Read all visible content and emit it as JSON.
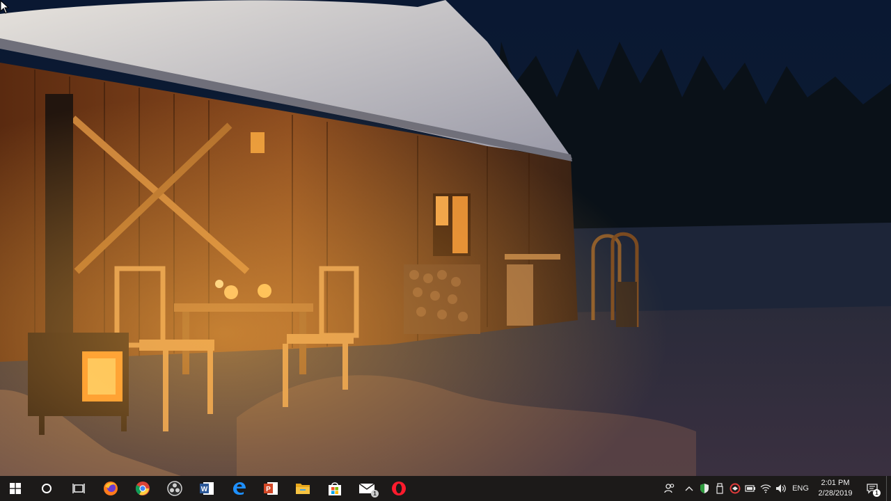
{
  "desktop": {
    "wallpaper": "snowy-cabin-at-night",
    "cursor": "arrow-cursor"
  },
  "taskbar": {
    "start": {
      "icon": "windows-logo-icon"
    },
    "search": {
      "icon": "cortana-circle-icon"
    },
    "task_view": {
      "icon": "task-view-icon"
    },
    "pinned": [
      {
        "name": "firefox",
        "icon": "firefox-icon",
        "color": "#ff7b1c"
      },
      {
        "name": "chrome",
        "icon": "chrome-icon",
        "color": "#4caf50"
      },
      {
        "name": "obs",
        "icon": "obs-icon",
        "color": "#d0d0d0"
      },
      {
        "name": "word",
        "icon": "word-icon",
        "color": "#2b5797"
      },
      {
        "name": "edge",
        "icon": "edge-icon",
        "color": "#1e90ff"
      },
      {
        "name": "powerpoint",
        "icon": "powerpoint-icon",
        "color": "#d24726"
      },
      {
        "name": "file-explorer",
        "icon": "folder-icon",
        "color": "#f6c342"
      },
      {
        "name": "store",
        "icon": "store-icon",
        "color": "#f25022"
      },
      {
        "name": "mail",
        "icon": "mail-icon",
        "color": "#ffffff",
        "badge": "1"
      },
      {
        "name": "opera",
        "icon": "opera-icon",
        "color": "#ff1b2d"
      }
    ],
    "tray": {
      "language": "ENG",
      "time": "2:01 PM",
      "date": "2/28/2019",
      "notification_count": "1"
    }
  }
}
